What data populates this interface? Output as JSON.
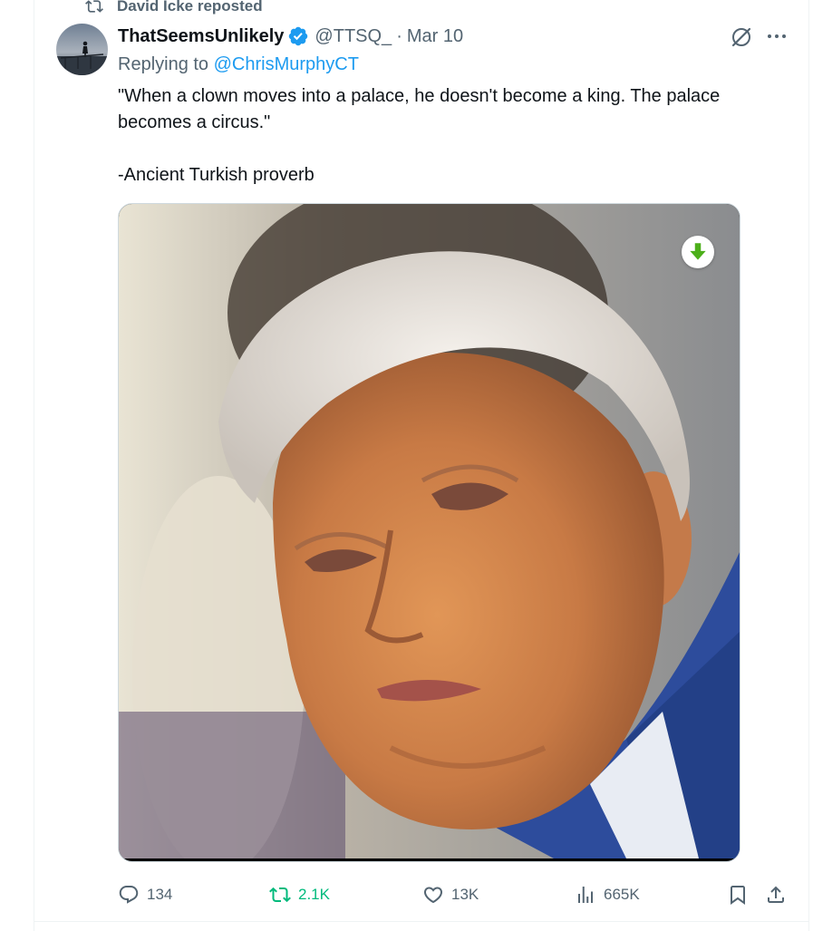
{
  "repost": {
    "label": "David Icke reposted",
    "icon": "repost-icon"
  },
  "tweet": {
    "author": {
      "display_name": "ThatSeemsUnlikely",
      "handle": "@TTSQ_",
      "verified": true,
      "avatar": "avatar-silhouette-on-pier"
    },
    "separator": "·",
    "date": "Mar 10",
    "replying_to_prefix": "Replying to",
    "replying_to_handle": "@ChrisMurphyCT",
    "text_paragraph_1": "\"When a clown moves into a palace, he doesn't become a king. The palace becomes a circus.\"",
    "text_paragraph_2": "-Ancient Turkish proverb",
    "media": {
      "type": "photo",
      "description_icon": "download-arrow-icon"
    }
  },
  "actions": {
    "reply_count": "134",
    "retweet_count": "2.1K",
    "like_count": "13K",
    "views_count": "665K"
  },
  "colors": {
    "accent": "#1d9bf0",
    "retweet_green": "#00ba7c",
    "secondary_text": "#536471",
    "primary_text": "#0f1419"
  }
}
